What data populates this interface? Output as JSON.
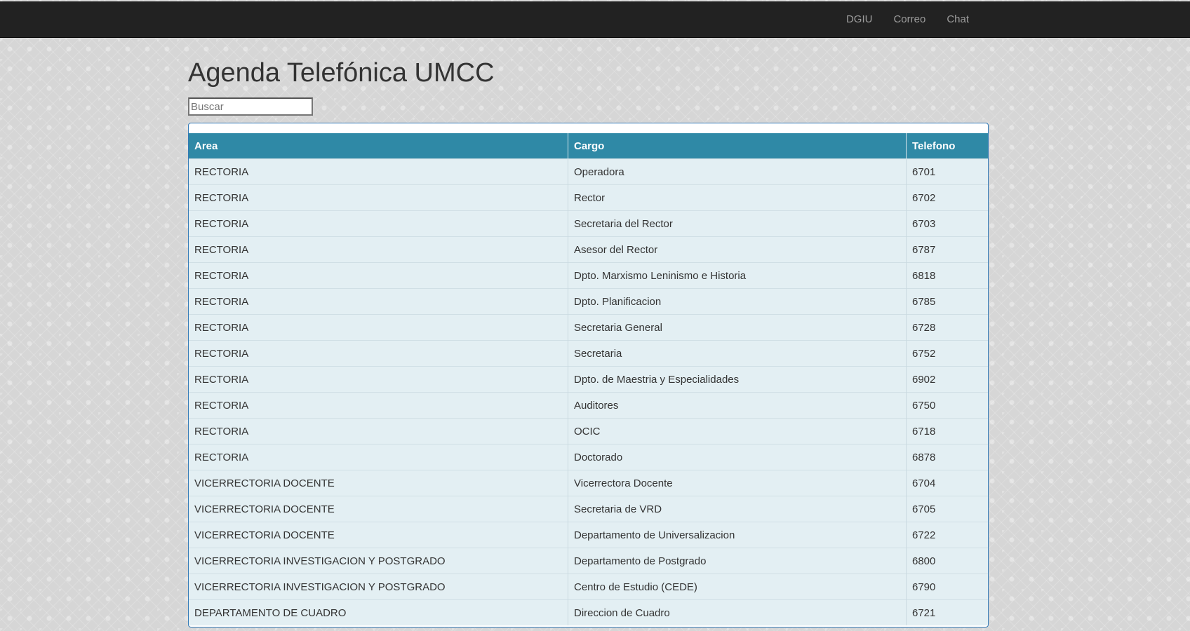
{
  "nav": {
    "links": [
      "DGIU",
      "Correo",
      "Chat"
    ]
  },
  "page": {
    "title": "Agenda Telefónica UMCC"
  },
  "search": {
    "placeholder": "Buscar",
    "value": ""
  },
  "table": {
    "headers": [
      "Area",
      "Cargo",
      "Telefono"
    ],
    "rows": [
      [
        "RECTORIA",
        "Operadora",
        "6701"
      ],
      [
        "RECTORIA",
        "Rector",
        "6702"
      ],
      [
        "RECTORIA",
        "Secretaria del Rector",
        "6703"
      ],
      [
        "RECTORIA",
        "Asesor del Rector",
        "6787"
      ],
      [
        "RECTORIA",
        "Dpto. Marxismo Leninismo e Historia",
        "6818"
      ],
      [
        "RECTORIA",
        "Dpto. Planificacion",
        "6785"
      ],
      [
        "RECTORIA",
        "Secretaria General",
        "6728"
      ],
      [
        "RECTORIA",
        "Secretaria",
        "6752"
      ],
      [
        "RECTORIA",
        "Dpto. de Maestria y Especialidades",
        "6902"
      ],
      [
        "RECTORIA",
        "Auditores",
        "6750"
      ],
      [
        "RECTORIA",
        "OCIC",
        "6718"
      ],
      [
        "RECTORIA",
        "Doctorado",
        "6878"
      ],
      [
        "VICERRECTORIA DOCENTE",
        "Vicerrectora Docente",
        "6704"
      ],
      [
        "VICERRECTORIA DOCENTE",
        "Secretaria de VRD",
        "6705"
      ],
      [
        "VICERRECTORIA DOCENTE",
        "Departamento de Universalizacion",
        "6722"
      ],
      [
        "VICERRECTORIA INVESTIGACION Y POSTGRADO",
        "Departamento de Postgrado",
        "6800"
      ],
      [
        "VICERRECTORIA INVESTIGACION Y POSTGRADO",
        "Centro de Estudio (CEDE)",
        "6790"
      ],
      [
        "DEPARTAMENTO DE CUADRO",
        "Direccion de Cuadro",
        "6721"
      ]
    ]
  },
  "colors": {
    "navbar": "#222222",
    "header": "#2f89a6",
    "row": "#e3eff3"
  }
}
